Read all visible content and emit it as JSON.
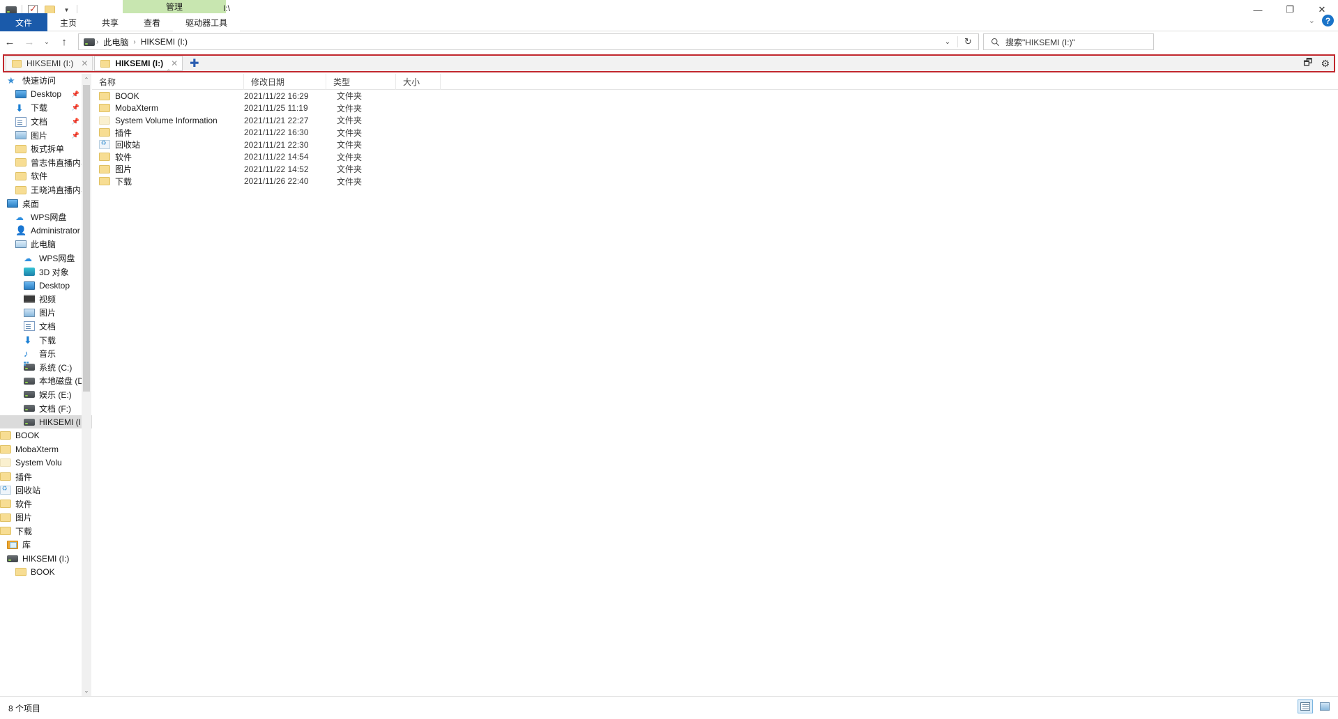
{
  "window": {
    "title": "I:\\",
    "quick_access_toolbar": [
      {
        "name": "drive-icon",
        "label": ""
      },
      {
        "name": "properties-icon",
        "label": ""
      },
      {
        "name": "new-folder-icon",
        "label": ""
      },
      {
        "name": "customize-chevron-icon",
        "label": "▾"
      }
    ],
    "controls": {
      "minimize": "—",
      "maximize": "❐",
      "close": "✕"
    }
  },
  "ribbon": {
    "contextual_tab_group": "管理",
    "tabs": [
      {
        "label": "文件",
        "active": true,
        "type": "file"
      },
      {
        "label": "主页",
        "active": false,
        "type": "normal"
      },
      {
        "label": "共享",
        "active": false,
        "type": "normal"
      },
      {
        "label": "查看",
        "active": false,
        "type": "normal"
      },
      {
        "label": "驱动器工具",
        "active": false,
        "type": "contextual"
      }
    ],
    "collapse_chevron": "⌄",
    "help_label": "?"
  },
  "address_bar": {
    "back": "←",
    "forward": "→",
    "recent_chevron": "⌄",
    "up": "↑",
    "breadcrumbs": [
      {
        "label": "此电脑",
        "icon": "drive-icon"
      },
      {
        "label": "HIKSEMI (I:)"
      }
    ],
    "separator": "›",
    "history_chevron": "⌄",
    "refresh": "↻",
    "search": {
      "icon": "search-icon",
      "placeholder": "搜索\"HIKSEMI (I:)\""
    }
  },
  "tab_strip": {
    "tabs": [
      {
        "label": "HIKSEMI (I:)",
        "active": false,
        "close": "✕"
      },
      {
        "label": "HIKSEMI (I:)",
        "active": true,
        "close": "✕"
      }
    ],
    "new_tab": "✚",
    "right_icons": [
      {
        "name": "new-window-icon",
        "glyph": "🗗"
      },
      {
        "name": "gear-icon",
        "glyph": "⚙"
      }
    ]
  },
  "nav_pane": {
    "scroll_up": "⌃",
    "scroll_down": "⌄",
    "items": [
      {
        "label": "快速访问",
        "icon": "star-icon",
        "level": 0,
        "pinned": false,
        "selected": false
      },
      {
        "label": "Desktop",
        "icon": "monitor-icon",
        "level": 1,
        "pinned": true,
        "selected": false
      },
      {
        "label": "下载",
        "icon": "download-icon",
        "level": 1,
        "pinned": true,
        "selected": false
      },
      {
        "label": "文档",
        "icon": "document-icon",
        "level": 1,
        "pinned": true,
        "selected": false
      },
      {
        "label": "图片",
        "icon": "picture-icon",
        "level": 1,
        "pinned": true,
        "selected": false
      },
      {
        "label": "板式拆单",
        "icon": "folder-icon",
        "level": 1,
        "pinned": false,
        "selected": false
      },
      {
        "label": "曾志伟直播内容",
        "icon": "folder-icon",
        "level": 1,
        "pinned": false,
        "selected": false
      },
      {
        "label": "软件",
        "icon": "folder-icon",
        "level": 1,
        "pinned": false,
        "selected": false
      },
      {
        "label": "王晓鸿直播内容",
        "icon": "folder-icon",
        "level": 1,
        "pinned": false,
        "selected": false
      },
      {
        "label": "桌面",
        "icon": "monitor-icon",
        "level": 0,
        "pinned": false,
        "selected": false
      },
      {
        "label": "WPS网盘",
        "icon": "cloud-icon",
        "level": 1,
        "pinned": false,
        "selected": false
      },
      {
        "label": "Administrator",
        "icon": "user-icon",
        "level": 1,
        "pinned": false,
        "selected": false
      },
      {
        "label": "此电脑",
        "icon": "pc-icon",
        "level": 1,
        "pinned": false,
        "selected": false
      },
      {
        "label": "WPS网盘",
        "icon": "cloud-icon",
        "level": 2,
        "pinned": false,
        "selected": false
      },
      {
        "label": "3D 对象",
        "icon": "cube-icon",
        "level": 2,
        "pinned": false,
        "selected": false
      },
      {
        "label": "Desktop",
        "icon": "monitor-icon",
        "level": 2,
        "pinned": false,
        "selected": false
      },
      {
        "label": "视频",
        "icon": "video-icon",
        "level": 2,
        "pinned": false,
        "selected": false
      },
      {
        "label": "图片",
        "icon": "picture-icon",
        "level": 2,
        "pinned": false,
        "selected": false
      },
      {
        "label": "文档",
        "icon": "document-icon",
        "level": 2,
        "pinned": false,
        "selected": false
      },
      {
        "label": "下载",
        "icon": "download-icon",
        "level": 2,
        "pinned": false,
        "selected": false
      },
      {
        "label": "音乐",
        "icon": "music-icon",
        "level": 2,
        "pinned": false,
        "selected": false
      },
      {
        "label": "系统 (C:)",
        "icon": "system-drive-icon",
        "level": 2,
        "pinned": false,
        "selected": false
      },
      {
        "label": "本地磁盘 (D:)",
        "icon": "drive-icon",
        "level": 2,
        "pinned": false,
        "selected": false
      },
      {
        "label": "娱乐 (E:)",
        "icon": "drive-icon",
        "level": 2,
        "pinned": false,
        "selected": false
      },
      {
        "label": "文档 (F:)",
        "icon": "drive-icon",
        "level": 2,
        "pinned": false,
        "selected": false
      },
      {
        "label": "HIKSEMI (I:)",
        "icon": "drive-icon",
        "level": 2,
        "pinned": false,
        "selected": true
      },
      {
        "label": "BOOK",
        "icon": "folder-icon",
        "level": 3,
        "pinned": false,
        "selected": false
      },
      {
        "label": "MobaXterm",
        "icon": "folder-icon",
        "level": 3,
        "pinned": false,
        "selected": false
      },
      {
        "label": "System Volu",
        "icon": "folder-dim-icon",
        "level": 3,
        "pinned": false,
        "selected": false
      },
      {
        "label": "插件",
        "icon": "folder-icon",
        "level": 3,
        "pinned": false,
        "selected": false
      },
      {
        "label": "回收站",
        "icon": "recycle-bin-icon",
        "level": 3,
        "pinned": false,
        "selected": false
      },
      {
        "label": "软件",
        "icon": "folder-icon",
        "level": 3,
        "pinned": false,
        "selected": false
      },
      {
        "label": "图片",
        "icon": "folder-icon",
        "level": 3,
        "pinned": false,
        "selected": false
      },
      {
        "label": "下载",
        "icon": "folder-icon",
        "level": 3,
        "pinned": false,
        "selected": false
      },
      {
        "label": "库",
        "icon": "library-icon",
        "level": 0,
        "pinned": false,
        "selected": false
      },
      {
        "label": "HIKSEMI (I:)",
        "icon": "drive-icon",
        "level": 0,
        "pinned": false,
        "selected": false
      },
      {
        "label": "BOOK",
        "icon": "folder-icon",
        "level": 1,
        "pinned": false,
        "selected": false
      }
    ]
  },
  "file_list": {
    "columns": [
      {
        "label": "名称",
        "key": "name"
      },
      {
        "label": "修改日期",
        "key": "date"
      },
      {
        "label": "类型",
        "key": "type"
      },
      {
        "label": "大小",
        "key": "size"
      }
    ],
    "sort_indicator": "⌃",
    "rows": [
      {
        "name": "BOOK",
        "date": "2021/11/22 16:29",
        "type": "文件夹",
        "size": "",
        "icon": "folder-icon",
        "dim": false
      },
      {
        "name": "MobaXterm",
        "date": "2021/11/25 11:19",
        "type": "文件夹",
        "size": "",
        "icon": "folder-icon",
        "dim": false
      },
      {
        "name": "System Volume Information",
        "date": "2021/11/21 22:27",
        "type": "文件夹",
        "size": "",
        "icon": "folder-dim-icon",
        "dim": true
      },
      {
        "name": "插件",
        "date": "2021/11/22 16:30",
        "type": "文件夹",
        "size": "",
        "icon": "folder-icon",
        "dim": false
      },
      {
        "name": "回收站",
        "date": "2021/11/21 22:30",
        "type": "文件夹",
        "size": "",
        "icon": "recycle-bin-icon",
        "dim": false
      },
      {
        "name": "软件",
        "date": "2021/11/22 14:54",
        "type": "文件夹",
        "size": "",
        "icon": "folder-icon",
        "dim": false
      },
      {
        "name": "图片",
        "date": "2021/11/22 14:52",
        "type": "文件夹",
        "size": "",
        "icon": "folder-icon",
        "dim": false
      },
      {
        "name": "下载",
        "date": "2021/11/26 22:40",
        "type": "文件夹",
        "size": "",
        "icon": "folder-icon",
        "dim": false
      }
    ]
  },
  "status_bar": {
    "item_count": "8 个项目",
    "view_buttons": [
      {
        "name": "details-view-button",
        "active": true
      },
      {
        "name": "large-icons-view-button",
        "active": false
      }
    ]
  },
  "colors": {
    "file_tab_blue": "#1a5aaa",
    "contextual_green": "#c8e6b0",
    "highlight_red": "#c1272d",
    "selection_gray": "#dbdbdb",
    "folder_yellow": "#f7dd93"
  }
}
